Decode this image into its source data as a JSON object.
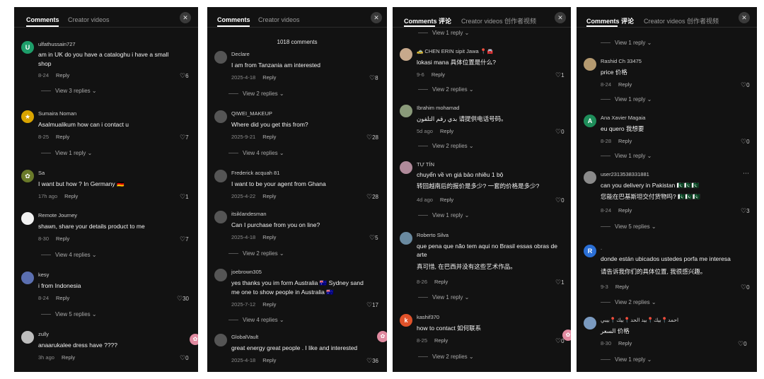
{
  "panels": [
    {
      "tabs": {
        "comments": "Comments",
        "creator": "Creator videos"
      },
      "comments": [
        {
          "user": "ulfathussain727",
          "text": [
            "am in UK do you have a cataloghu i have a small",
            "shop"
          ],
          "date": "8-24",
          "reply": "Reply",
          "likes": "6",
          "replies": "View 3 replies",
          "avatar_letter": "U",
          "avatar_color": "#1e9e6a"
        },
        {
          "user": "Sumaira Noman",
          "text": [
            "Asalmualikum how can i contact u"
          ],
          "date": "8-25",
          "reply": "Reply",
          "likes": "7",
          "replies": "View 1 reply",
          "avatar_letter": "★",
          "avatar_color": "#d9a400"
        },
        {
          "user": "Sa",
          "text": [
            "I want but how ? In Germany 🇩🇪"
          ],
          "date": "17h ago",
          "reply": "Reply",
          "likes": "1",
          "replies": "",
          "avatar_letter": "✿",
          "avatar_color": "#6a7a2a"
        },
        {
          "user": "Remote Journey",
          "text": [
            "shawn, share your details product to me"
          ],
          "date": "8-30",
          "reply": "Reply",
          "likes": "7",
          "replies": "View 4 replies",
          "avatar_letter": "",
          "avatar_color": "#f2f2f2"
        },
        {
          "user": "kesy",
          "text": [
            "i from Indonesia"
          ],
          "date": "8-24",
          "reply": "Reply",
          "likes": "30",
          "replies": "View 5 replies",
          "avatar_letter": "",
          "avatar_color": "#5b6fb0"
        },
        {
          "user": "zully",
          "text": [
            "anaarukalee dress have ????"
          ],
          "date": "3h ago",
          "reply": "Reply",
          "likes": "0",
          "replies": "",
          "avatar_letter": "",
          "avatar_color": "#bdbdbd"
        }
      ]
    },
    {
      "tabs": {
        "comments": "Comments",
        "creator": "Creator videos"
      },
      "count": "1018 comments",
      "comments": [
        {
          "user": "Declare",
          "text": [
            "I am from Tanzania am interested"
          ],
          "date": "2025-4-18",
          "reply": "Reply",
          "likes": "8",
          "replies": "View 2 replies",
          "avatar_color": "#555555"
        },
        {
          "user": "QIWEI_MAKEUP",
          "text": [
            "Where did you get this from?"
          ],
          "date": "2025-9-21",
          "reply": "Reply",
          "likes": "28",
          "replies": "View 4 replies",
          "avatar_color": "#555555"
        },
        {
          "user": "Frederick acquah 81",
          "text": [
            "I want to be your agent from Ghana"
          ],
          "date": "2025-4-22",
          "reply": "Reply",
          "likes": "28",
          "replies": "",
          "avatar_color": "#555555"
        },
        {
          "user": "itsiklandesman",
          "text": [
            "Can I purchase from you on line?"
          ],
          "date": "2025-4-18",
          "reply": "Reply",
          "likes": "5",
          "replies": "View 2 replies",
          "avatar_color": "#555555"
        },
        {
          "user": "joebrown305",
          "text": [
            "yes thanks you im form Australia 🇦🇺 Sydney sand",
            "me one to show people in Australia 🇦🇺"
          ],
          "date": "2025-7-12",
          "reply": "Reply",
          "likes": "17",
          "replies": "View 4 replies",
          "avatar_color": "#555555"
        },
        {
          "user": "GlobalVault",
          "text": [
            "great energy great people . I like and interested"
          ],
          "date": "2025-4-18",
          "reply": "Reply",
          "likes": "36",
          "replies": "",
          "avatar_color": "#555555"
        }
      ]
    },
    {
      "tabs": {
        "comments": "Comments 评论",
        "creator": "Creator videos 创作者视频"
      },
      "top_reply": "View 1 reply",
      "comments": [
        {
          "user": "🚕 CHEN ERIN sipit Jawa 📍🚘",
          "text": [
            "lokasi mana 具体位置是什么?"
          ],
          "date": "9-6",
          "reply": "Reply",
          "likes": "1",
          "replies": "View 2 replies",
          "avatar_color": "#c7a98c"
        },
        {
          "user": "Ibrahim mohamad",
          "text": [
            "بدي رقم التلفون 请提供电话号码。"
          ],
          "date": "5d ago",
          "reply": "Reply",
          "likes": "0",
          "replies": "View 2 replies",
          "avatar_color": "#8a9a7a"
        },
        {
          "user": "TỰ TÍN",
          "text": [
            "chuyển về vn giá bảo nhiêu 1 bộ",
            "转回越南后的报价是多少? 一套的价格是多少?"
          ],
          "date": "4d ago",
          "reply": "Reply",
          "likes": "0",
          "replies": "View 1 reply",
          "avatar_color": "#b08a9a"
        },
        {
          "user": "Roberto Silva",
          "text": [
            "que pena que não tem aqui no Brasil essas obras de",
            "arte",
            "真可惜, 在巴西并没有这些艺术作品。"
          ],
          "date": "8-26",
          "reply": "Reply",
          "likes": "1",
          "replies": "View 1 reply",
          "avatar_color": "#6a8aa0"
        },
        {
          "user": "kashif370",
          "text": [
            "how to contact 如何联系"
          ],
          "date": "8-25",
          "reply": "Reply",
          "likes": "0",
          "replies": "View 2 replies",
          "avatar_letter": "k",
          "avatar_color": "#e0522a"
        }
      ]
    },
    {
      "tabs": {
        "comments": "Comments 评论",
        "creator": "Creator videos 创作者视频"
      },
      "top_reply": "View 1 reply",
      "comments": [
        {
          "user": "Rashid Ch 33475",
          "text": [
            "price 价格"
          ],
          "date": "8-24",
          "reply": "Reply",
          "likes": "0",
          "replies": "View 1 reply",
          "avatar_color": "#b59a70"
        },
        {
          "user": "Ana Xavier Magaia",
          "text": [
            "eu quero 我想要"
          ],
          "date": "8-28",
          "reply": "Reply",
          "likes": "0",
          "replies": "View 1 reply",
          "avatar_letter": "A",
          "avatar_color": "#1e8e5a"
        },
        {
          "user": "user2313538331881",
          "text": [
            "can you delivery in Pakistan 🇵🇰🇵🇰🇵🇰",
            "您能在巴基斯坦交付货物吗? 🇵🇰🇵🇰🇵🇰"
          ],
          "date": "8-24",
          "reply": "Reply",
          "likes": "3",
          "replies": "View 5 replies",
          "avatar_color": "#8a8a8a"
        },
        {
          "user": ".",
          "text": [
            "donde están ubicados ustedes porfa me interesa",
            "请告诉我你们的具体位置, 我很感兴趣。"
          ],
          "date": "9-3",
          "reply": "Reply",
          "likes": "0",
          "replies": "View 2 replies",
          "avatar_letter": "R",
          "avatar_color": "#2a6fd6"
        },
        {
          "user": "احمد📍بيك📍بيد الحد📍بيك📍بيبي",
          "text": [
            "السعر 价格"
          ],
          "date": "8-30",
          "reply": "Reply",
          "likes": "0",
          "replies": "View 1 reply",
          "avatar_color": "#7a9ac0"
        }
      ]
    }
  ]
}
